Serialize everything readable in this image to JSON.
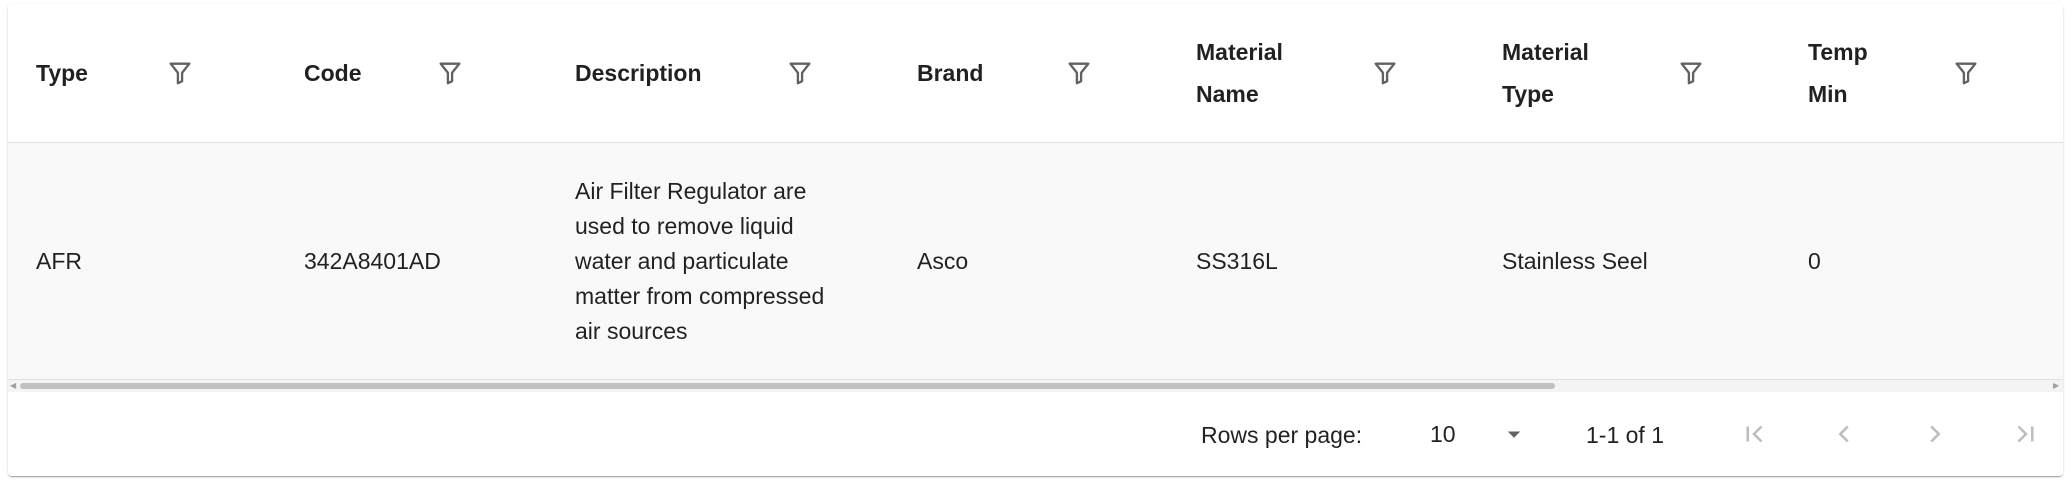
{
  "table": {
    "columns": [
      {
        "label_lines": [
          "Type"
        ]
      },
      {
        "label_lines": [
          "Code"
        ]
      },
      {
        "label_lines": [
          "Description"
        ]
      },
      {
        "label_lines": [
          "Brand"
        ]
      },
      {
        "label_lines": [
          "Material",
          "Name"
        ]
      },
      {
        "label_lines": [
          "Material",
          "Type"
        ]
      },
      {
        "label_lines": [
          "Temp",
          "Min"
        ]
      }
    ],
    "rows": [
      {
        "type": "AFR",
        "code": "342A8401AD",
        "description_lines": [
          "Air Filter Regulator are",
          "used to remove liquid",
          "water and particulate",
          "matter from compressed",
          "air sources"
        ],
        "brand": "Asco",
        "material_name": "SS316L",
        "material_type": "Stainless Seel",
        "temp_min": "0"
      }
    ]
  },
  "pagination": {
    "rows_per_page_label": "Rows per page:",
    "rows_per_page_value": "10",
    "range_label": "1-1 of 1"
  },
  "icons": {
    "filter": "filter-icon",
    "dropdown": "arrow-drop-down-icon",
    "first_page": "first-page-icon",
    "prev_page": "chevron-left-icon",
    "next_page": "chevron-right-icon",
    "last_page": "last-page-icon"
  },
  "colors": {
    "header_bg": "#ffffff",
    "row_bg": "#f9f9f9",
    "divider": "#e0e0e0",
    "icon_active": "#757575",
    "icon_disabled": "#bdbdbd"
  }
}
